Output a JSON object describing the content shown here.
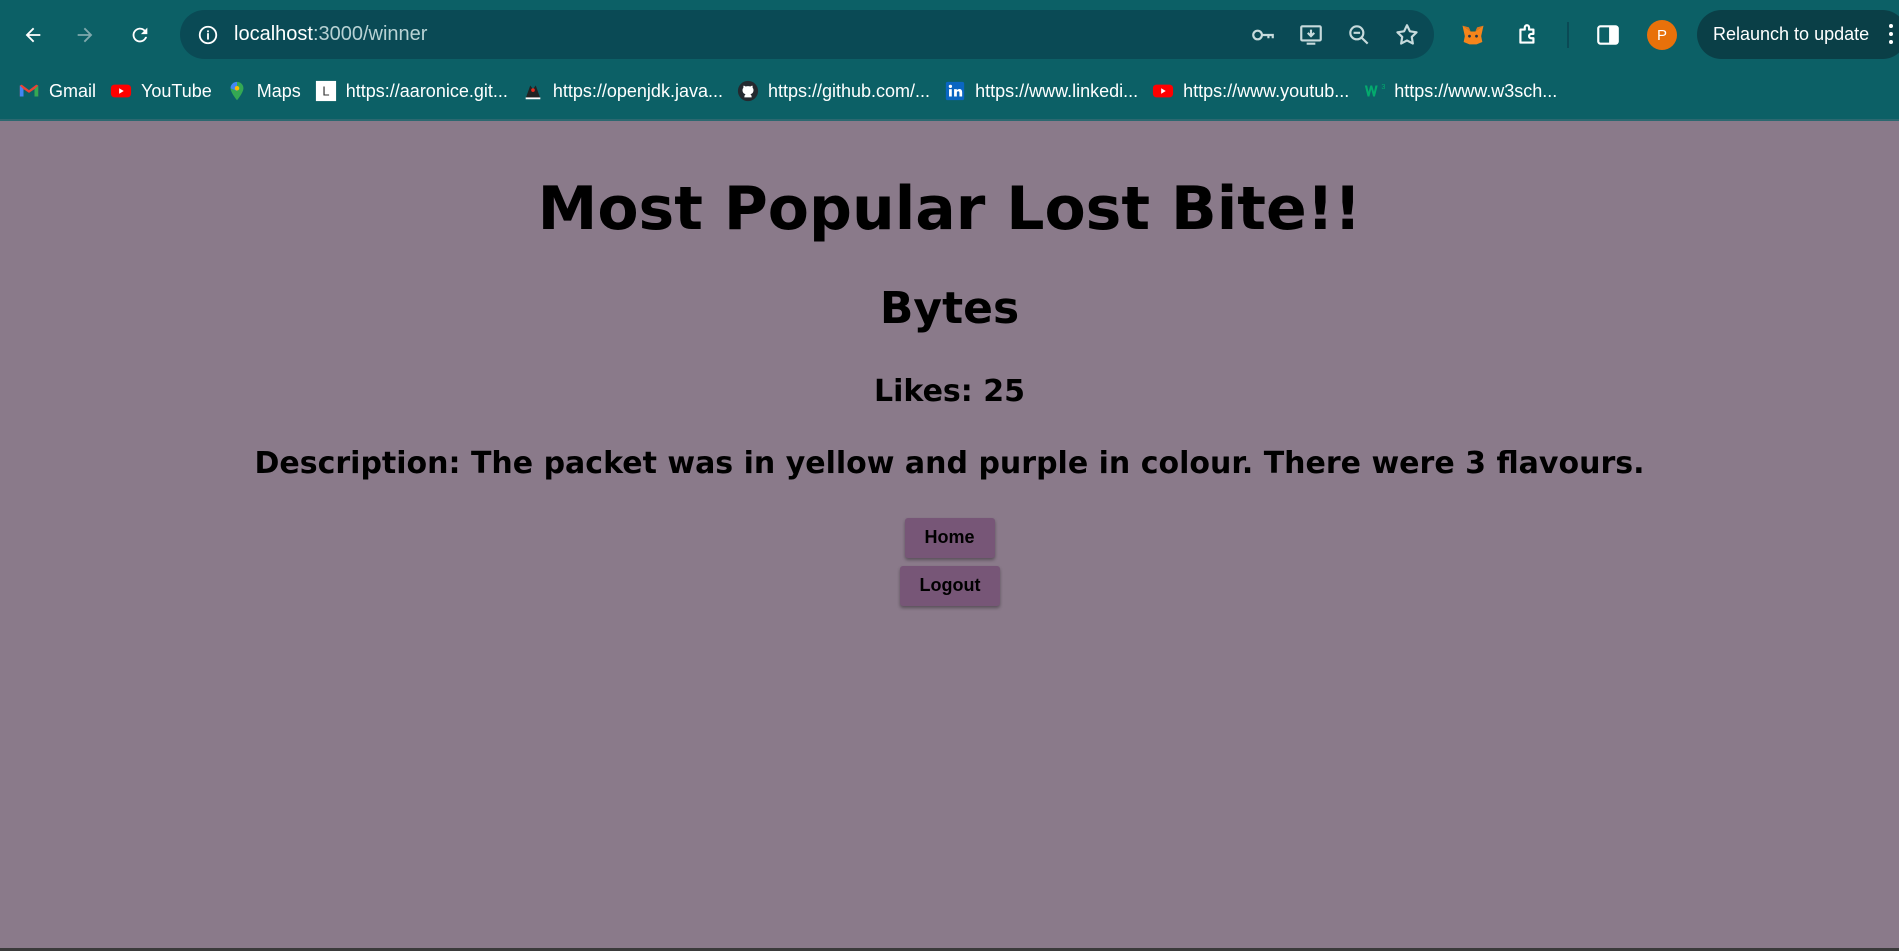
{
  "browser": {
    "url_host": "localhost",
    "url_path": ":3000/winner",
    "relaunch_label": "Relaunch to update",
    "avatar_letter": "P",
    "bookmarks": [
      {
        "label": "Gmail",
        "icon": "gmail-icon"
      },
      {
        "label": "YouTube",
        "icon": "youtube-icon"
      },
      {
        "label": "Maps",
        "icon": "maps-icon"
      },
      {
        "label": "https://aaronice.git...",
        "icon": "l-letter-icon"
      },
      {
        "label": "https://openjdk.java...",
        "icon": "duke-icon"
      },
      {
        "label": "https://github.com/...",
        "icon": "github-icon"
      },
      {
        "label": "https://www.linkedi...",
        "icon": "linkedin-icon"
      },
      {
        "label": "https://www.youtub...",
        "icon": "youtube-icon"
      },
      {
        "label": "https://www.w3sch...",
        "icon": "w3schools-icon"
      }
    ]
  },
  "page": {
    "title": "Most Popular Lost Bite!!",
    "item_name": "Bytes",
    "likes": "Likes: 25",
    "description": "Description: The packet was in yellow and purple in colour. There were 3 flavours.",
    "home_label": "Home",
    "logout_label": "Logout"
  },
  "colors": {
    "chrome_bg": "#0c6066",
    "page_bg": "#8a7a8a",
    "button_bg": "#775677"
  }
}
